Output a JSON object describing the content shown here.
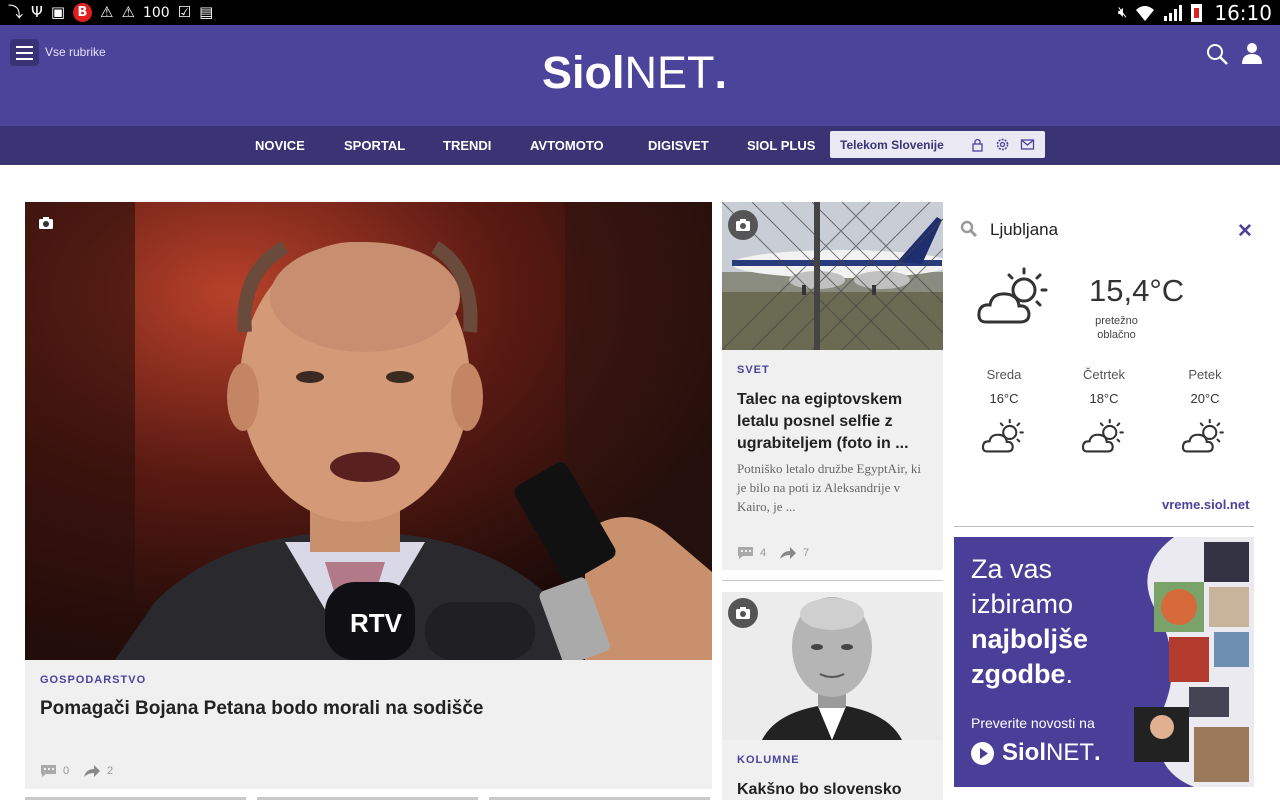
{
  "status_bar": {
    "notif_100": "100",
    "b_badge": "B",
    "time": "16:10"
  },
  "header": {
    "menu_label": "Vse rubrike",
    "logo_bold": "Siol",
    "logo_light": "NET",
    "logo_dot": "."
  },
  "nav": {
    "items": [
      "NOVICE",
      "SPORTAL",
      "TRENDI",
      "AVTOMOTO",
      "DIGISVET",
      "SIOL PLUS"
    ],
    "telekom_label": "Telekom Slovenije"
  },
  "main_article": {
    "category": "GOSPODARSTVO",
    "title": "Pomagači Bojana Petana bodo morali na sodišče",
    "comments": "0",
    "shares": "2"
  },
  "side_articles": [
    {
      "category": "SVET",
      "title": "Talec na egiptovskem letalu posnel selfie z ugrabiteljem (foto in ...",
      "excerpt": "Potniško letalo družbe EgyptAir, ki je bilo na poti iz Aleksandrije v Kairo, je ...",
      "comments": "4",
      "shares": "7"
    },
    {
      "category": "KOLUMNE",
      "title": "Kakšno bo slovensko"
    }
  ],
  "weather": {
    "city": "Ljubljana",
    "close_icon": "close-icon",
    "temperature": "15,4°C",
    "description": "pretežno oblačno",
    "forecast": [
      {
        "day": "Sreda",
        "temp": "16°C"
      },
      {
        "day": "Četrtek",
        "temp": "18°C"
      },
      {
        "day": "Petek",
        "temp": "20°C"
      }
    ],
    "link": "vreme.siol.net"
  },
  "ad": {
    "line1": "Za vas",
    "line2": "izbiramo",
    "line3": "najboljše",
    "line4": "zgodbe",
    "line4_dot": ".",
    "prompt": "Preverite novosti na",
    "logo_bold": "Siol",
    "logo_light": "NET",
    "logo_dot": "."
  },
  "colors": {
    "brand": "#4c439b",
    "nav": "#3a3474",
    "card_bg": "#f0f0f0"
  }
}
